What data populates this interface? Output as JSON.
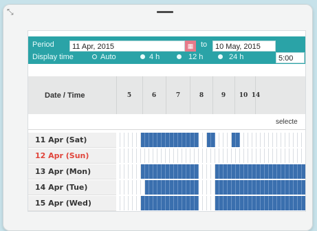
{
  "filter": {
    "period_label": "Period",
    "start_date": "11 Apr, 2015",
    "to_label": "to",
    "end_date": "10 May, 2015",
    "display_time_label": "Display time",
    "options": [
      "Auto",
      "4 h",
      "12 h",
      "24 h"
    ],
    "selected_option": "4 h",
    "time_value": "5:00"
  },
  "table": {
    "header_title": "Date / Time",
    "hours": [
      "5",
      "6",
      "7",
      "8",
      "9",
      "10",
      "14"
    ],
    "select_text": "selecte",
    "days": [
      {
        "label": "11 Apr (Sat)",
        "sunday": false
      },
      {
        "label": "12 Apr (Sun)",
        "sunday": true
      },
      {
        "label": "13 Apr (Mon)",
        "sunday": false
      },
      {
        "label": "14 Apr (Tue)",
        "sunday": false
      },
      {
        "label": "15 Apr (Wed)",
        "sunday": false
      }
    ]
  },
  "colors": {
    "bar": "#2aa3a7",
    "booked": "#3a6fae",
    "sunday": "#e0443a"
  },
  "icons": [
    "resize-corner-icon",
    "calendar-icon"
  ]
}
